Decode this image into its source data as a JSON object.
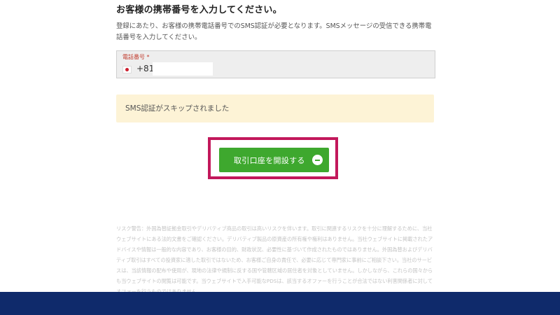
{
  "form": {
    "title": "お客様の携帯番号を入力してください。",
    "description": "登録にあたり、お客様の携帯電話番号でのSMS認証が必要となります。SMSメッセージの受信できる携帯電話番号を入力してください。",
    "phone": {
      "label": "電話番号",
      "required_mark": "*",
      "country_flag_icon": "japan-flag-icon",
      "country_code": "+81",
      "value": "",
      "placeholder": ""
    }
  },
  "notice": {
    "text": "SMS認証がスキップされました"
  },
  "actions": {
    "open_account_label": "取引口座を開設する",
    "open_account_icon": "arrow-circle-icon",
    "highlight_color": "#c2185b",
    "button_color": "#3ea82e"
  },
  "disclaimer": {
    "text": "リスク警告：外国為替証拠金取引やデリバティブ商品の取引は高いリスクを伴います。取引に関連するリスクを十分に理解するために、当社ウェブサイトにある法的文書をご確認ください。デリバティブ製品の原資産の所有権や権利はありません。当社ウェブサイトに掲載されたアドバイスや情報は一般的な内容であり、お客様の目的、財政状況、必要性に基づいて作成されたものではありません。外国為替およびデリバティブ取引はすべての投資家に適した取引ではないため、お客様ご自身の責任で、必要に応じて専門家に事前にご相談下さい。当社のサービスは、当該情報の配布や使用が、現地の法律や規制に反する国や管轄区域の居住者を対象としていません。しかしながら、これらの国々からも当ウェブサイトの閲覧は可能です。当ウェブサイトで入手可能なPDSは、該当するオファーを行うことが合法ではない利害関係者に対してオファーを行うものではありません。"
  },
  "colors": {
    "footer_bar": "#0f2a6b",
    "notice_background": "#fdf3d6"
  }
}
